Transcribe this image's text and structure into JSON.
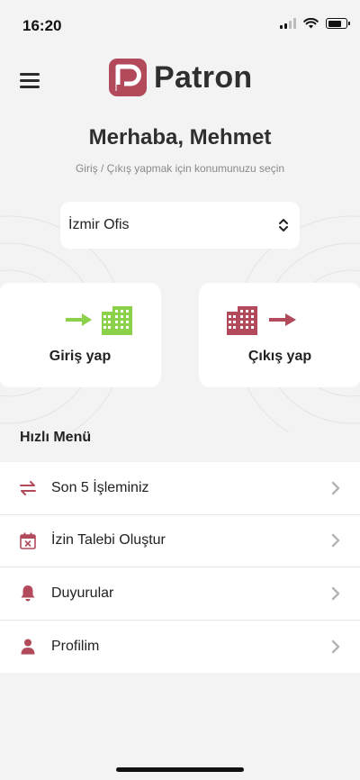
{
  "status_bar": {
    "time": "16:20"
  },
  "header": {
    "app_name": "Patron"
  },
  "greeting": {
    "title": "Merhaba, Mehmet",
    "subtitle": "Giriş / Çıkış yapmak için konumunuzu seçin"
  },
  "location": {
    "selected": "İzmir Ofis"
  },
  "actions": {
    "checkin_label": "Giriş yap",
    "checkout_label": "Çıkış yap"
  },
  "quick_menu": {
    "title": "Hızlı Menü",
    "items": [
      {
        "label": "Son 5 İşleminiz",
        "icon": "transfer-arrows-icon"
      },
      {
        "label": "İzin Talebi Oluştur",
        "icon": "calendar-x-icon"
      },
      {
        "label": "Duyurular",
        "icon": "bell-icon"
      },
      {
        "label": "Profilim",
        "icon": "user-icon"
      }
    ]
  },
  "colors": {
    "brand": "#b24a5c",
    "accent_green": "#8cd14a",
    "background": "#f3f3f3"
  }
}
